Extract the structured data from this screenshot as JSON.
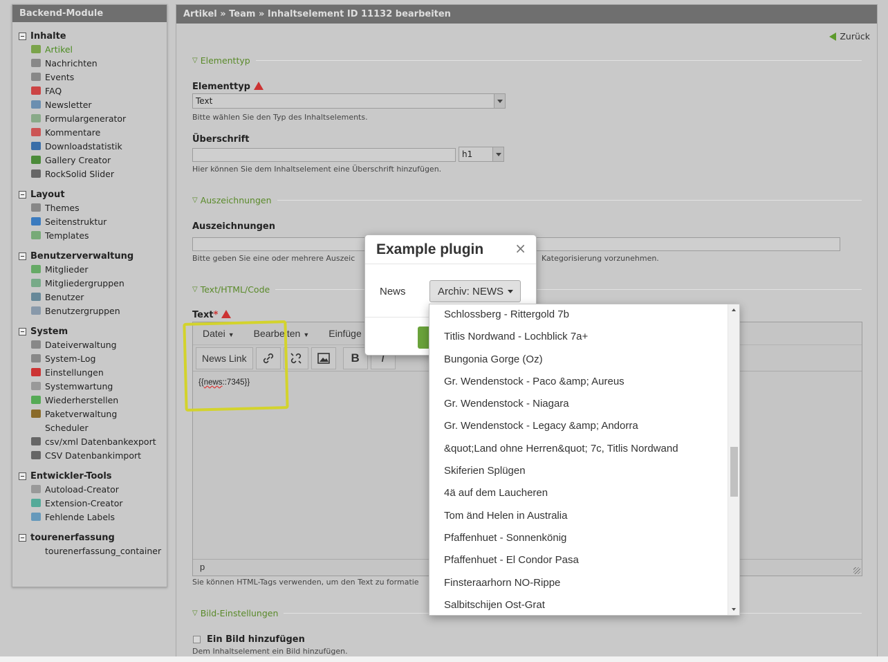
{
  "sidebar": {
    "title": "Backend-Module",
    "groups": [
      {
        "title": "Inhalte",
        "items": [
          "Artikel",
          "Nachrichten",
          "Events",
          "FAQ",
          "Newsletter",
          "Formulargenerator",
          "Kommentare",
          "Downloadstatistik",
          "Gallery Creator",
          "RockSolid Slider"
        ]
      },
      {
        "title": "Layout",
        "items": [
          "Themes",
          "Seitenstruktur",
          "Templates"
        ]
      },
      {
        "title": "Benutzerverwaltung",
        "items": [
          "Mitglieder",
          "Mitgliedergruppen",
          "Benutzer",
          "Benutzergruppen"
        ]
      },
      {
        "title": "System",
        "items": [
          "Dateiverwaltung",
          "System-Log",
          "Einstellungen",
          "Systemwartung",
          "Wiederherstellen",
          "Paketverwaltung",
          "Scheduler",
          "csv/xml Datenbankexport",
          "CSV Datenbankimport"
        ]
      },
      {
        "title": "Entwickler-Tools",
        "items": [
          "Autoload-Creator",
          "Extension-Creator",
          "Fehlende Labels"
        ]
      },
      {
        "title": "tourenerfassung",
        "items": [
          "tourenerfassung_container"
        ]
      }
    ]
  },
  "header": {
    "breadcrumb": "Artikel » Team » Inhaltselement ID 11132 bearbeiten"
  },
  "back_label": "Zurück",
  "sections": {
    "elementtyp_legend": "Elementtyp",
    "elementtyp_label": "Elementtyp",
    "elementtyp_value": "Text",
    "elementtyp_help": "Bitte wählen Sie den Typ des Inhaltselements.",
    "headline_label": "Überschrift",
    "headline_value": "",
    "headline_level": "h1",
    "headline_help": "Hier können Sie dem Inhaltselement eine Überschrift hinzufügen.",
    "auszeichnungen_legend": "Auszeichnungen",
    "auszeichnungen_label": "Auszeichnungen",
    "auszeichnungen_help_left": "Bitte geben Sie eine oder mehrere Auszeic",
    "auszeichnungen_help_right": "Kategorisierung vorzunehmen.",
    "text_legend": "Text/HTML/Code",
    "text_label": "Text",
    "text_required": "*",
    "text_help": "Sie können HTML-Tags verwenden, um den Text zu formatie",
    "bild_legend": "Bild-Einstellungen",
    "bild_checkbox_label": "Ein Bild hinzufügen",
    "bild_help": "Dem Inhaltselement ein Bild hinzufügen."
  },
  "editor": {
    "menu": [
      "Datei",
      "Bearbeiten",
      "Einfüge"
    ],
    "news_link_button": "News Link",
    "content_open": "{{",
    "content_word": "news",
    "content_rest": "::7345}}",
    "status_path": "p"
  },
  "modal": {
    "title": "Example plugin",
    "close": "×",
    "field_label": "News",
    "dropdown_value": "Archiv: NEWS"
  },
  "dropdown_items": [
    "Schlossberg - Rittergold 7b",
    "Titlis Nordwand - Lochblick 7a+",
    "Bungonia Gorge (Oz)",
    "Gr. Wendenstock - Paco &amp; Aureus",
    "Gr. Wendenstock - Niagara",
    "Gr. Wendenstock - Legacy &amp; Andorra",
    "&quot;Land ohne Herren&quot; 7c, Titlis Nordwand",
    "Skiferien Splügen",
    "4ä auf dem Laucheren",
    "Tom änd Helen in Australia",
    "Pfaffenhuet - Sonnenkönig",
    "Pfaffenhuet - El Condor Pasa",
    "Finsteraarhorn NO-Rippe",
    "Salbitschijen Ost-Grat"
  ],
  "colors": {
    "accent": "#5a8a2a",
    "header_bg": "#6f6f6f",
    "highlight": "#d3d32c",
    "ok_button": "#6aa33b"
  }
}
